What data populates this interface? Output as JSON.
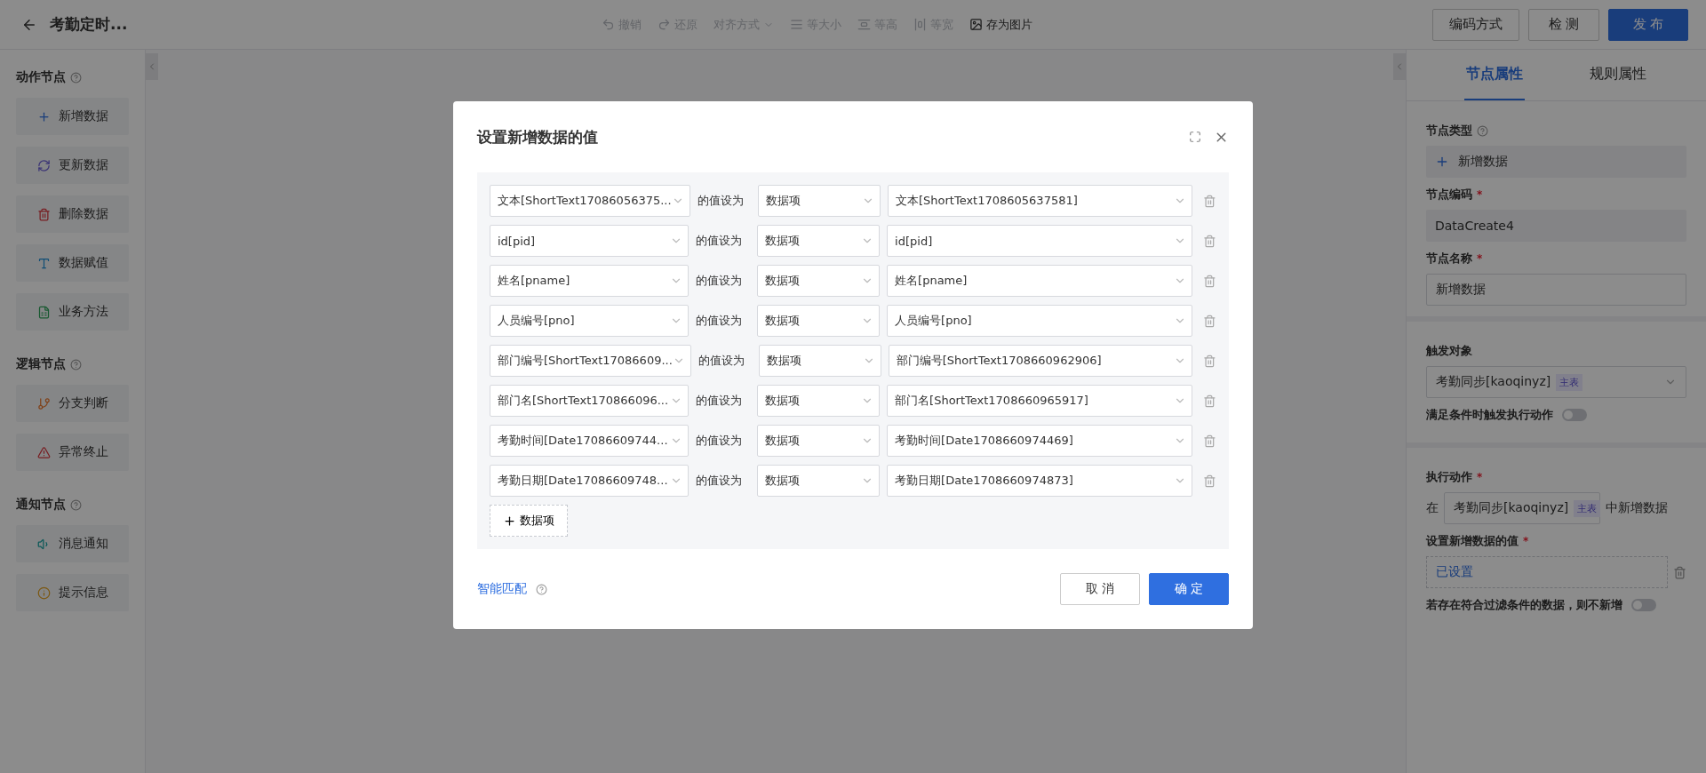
{
  "header": {
    "title": "考勤定时...",
    "toolbar": [
      {
        "label": "撤销",
        "disabled": true
      },
      {
        "label": "还原",
        "disabled": true
      },
      {
        "label": "对齐方式",
        "disabled": true
      },
      {
        "label": "等大小",
        "disabled": true
      },
      {
        "label": "等高",
        "disabled": true
      },
      {
        "label": "等宽",
        "disabled": true
      },
      {
        "label": "存为图片",
        "disabled": false
      }
    ],
    "buttons": [
      {
        "label": "编码方式",
        "kind": "default"
      },
      {
        "label": "检 测",
        "kind": "default"
      },
      {
        "label": "发 布",
        "kind": "primary"
      }
    ]
  },
  "sidebar": {
    "groups": [
      {
        "title": "动作节点",
        "items": [
          {
            "label": "新增数据"
          },
          {
            "label": "更新数据"
          },
          {
            "label": "删除数据"
          },
          {
            "label": "数据赋值"
          },
          {
            "label": "业务方法"
          }
        ]
      },
      {
        "title": "逻辑节点",
        "items": [
          {
            "label": "分支判断"
          },
          {
            "label": "异常终止"
          }
        ]
      },
      {
        "title": "通知节点",
        "items": [
          {
            "label": "消息通知"
          },
          {
            "label": "提示信息"
          }
        ]
      }
    ]
  },
  "properties": {
    "tabs": [
      {
        "label": "节点属性",
        "selected": true
      },
      {
        "label": "规则属性",
        "selected": false
      }
    ],
    "node_type": {
      "label": "节点类型",
      "value": "新增数据"
    },
    "node_code": {
      "label": "节点编码",
      "required_mark": "*",
      "value": "DataCreate4"
    },
    "node_name": {
      "label": "节点名称",
      "required_mark": "*",
      "value": "新增数据"
    },
    "trigger": {
      "label": "触发对象",
      "value": "考勤同步[kaoqinyz]",
      "tag": "主表"
    },
    "trigger_toggle": {
      "label": "满足条件时触发执行动作",
      "on": false
    },
    "action": {
      "label": "执行动作",
      "required_mark": "*",
      "prefix": "在",
      "value": "考勤同步[kaoqinyz]",
      "tag": "主表",
      "suffix": "中新增数据"
    },
    "values": {
      "label": "设置新增数据的值",
      "required_mark": "*",
      "value": "已设置"
    },
    "skip_toggle": {
      "label": "若存在符合过滤条件的数据，则不新增",
      "on": false
    }
  },
  "dialog": {
    "title": "设置新增数据的值",
    "rows": [
      {
        "field": "文本[ShortText17086056375...",
        "connector": "的值设为",
        "source": "数据项",
        "value": "文本[ShortText1708605637581]"
      },
      {
        "field": "id[pid]",
        "connector": "的值设为",
        "source": "数据项",
        "value": "id[pid]"
      },
      {
        "field": "姓名[pname]",
        "connector": "的值设为",
        "source": "数据项",
        "value": "姓名[pname]"
      },
      {
        "field": "人员编号[pno]",
        "connector": "的值设为",
        "source": "数据项",
        "value": "人员编号[pno]"
      },
      {
        "field": "部门编号[ShortText17086609...",
        "connector": "的值设为",
        "source": "数据项",
        "value": "部门编号[ShortText1708660962906]"
      },
      {
        "field": "部门名[ShortText170866096...",
        "connector": "的值设为",
        "source": "数据项",
        "value": "部门名[ShortText1708660965917]"
      },
      {
        "field": "考勤时间[Date17086609744...",
        "connector": "的值设为",
        "source": "数据项",
        "value": "考勤时间[Date1708660974469]"
      },
      {
        "field": "考勤日期[Date17086609748...",
        "connector": "的值设为",
        "source": "数据项",
        "value": "考勤日期[Date1708660974873]"
      }
    ],
    "add_button": "数据项",
    "smart_match": "智能匹配",
    "cancel": "取 消",
    "confirm": "确 定"
  }
}
